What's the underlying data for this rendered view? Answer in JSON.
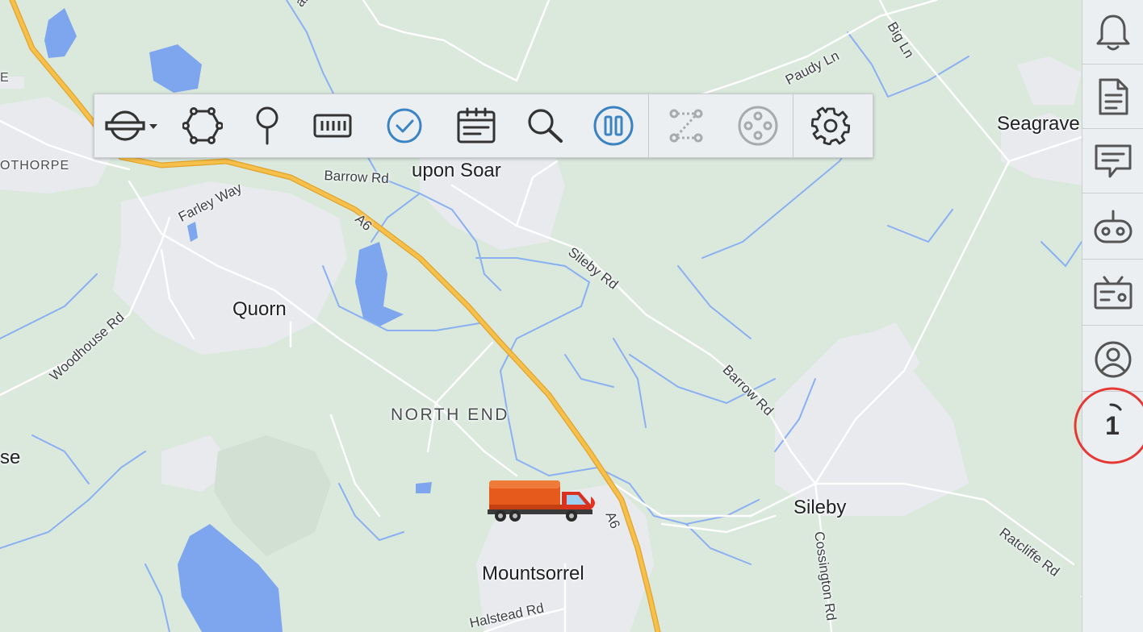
{
  "map": {
    "places": {
      "upon_soar": "upon Soar",
      "quorn": "Quorn",
      "north_end": "NORTH END",
      "mountsorrel": "Mountsorrel",
      "sileby": "Sileby",
      "seagrave": "Seagrave",
      "othorpe": "OTHORPE",
      "se": "se",
      "e_edge": "E",
      "ar_top": "ar"
    },
    "roads": {
      "barrow_rd_1": "Barrow Rd",
      "farley_way": "Farley Way",
      "a6_north": "A6",
      "a6_south": "A6",
      "sileby_rd": "Sileby Rd",
      "barrow_rd_2": "Barrow Rd",
      "woodhouse_rd": "Woodhouse Rd",
      "paudy_ln": "Paudy Ln",
      "big_ln": "Big Ln",
      "cossington_rd": "Cossington Rd",
      "ratcliffe_rd": "Ratcliffe Rd",
      "halstead_rd": "Halstead Rd"
    },
    "colors": {
      "land": "#dbe9dd",
      "urban": "#e8eaed",
      "water": "#7ea6ee",
      "stream": "#8ab0f2",
      "road": "#ffffff",
      "highway": "#f7c04a",
      "highway_edge": "#e0a32e"
    }
  },
  "toolbar": {
    "buttons": [
      {
        "name": "map-layers",
        "icon": "layers-icon"
      },
      {
        "name": "polygon",
        "icon": "polygon-icon"
      },
      {
        "name": "pin",
        "icon": "pin-icon"
      },
      {
        "name": "ruler",
        "icon": "ruler-icon"
      },
      {
        "name": "check",
        "icon": "check-circle-icon",
        "active": true
      },
      {
        "name": "calendar",
        "icon": "calendar-icon"
      },
      {
        "name": "search",
        "icon": "search-icon"
      },
      {
        "name": "pause",
        "icon": "pause-icon",
        "active": true
      },
      {
        "name": "route",
        "icon": "route-icon",
        "disabled": true
      },
      {
        "name": "cluster",
        "icon": "cluster-icon",
        "disabled": true
      },
      {
        "name": "settings",
        "icon": "gear-icon"
      }
    ],
    "colors": {
      "active": "#3a84c4",
      "normal": "#333333",
      "disabled": "#a8abad"
    }
  },
  "sidebar": {
    "items": [
      {
        "name": "notifications",
        "icon": "bell-icon"
      },
      {
        "name": "documents",
        "icon": "document-icon"
      },
      {
        "name": "messages",
        "icon": "message-icon"
      },
      {
        "name": "devices",
        "icon": "gamepad-icon"
      },
      {
        "name": "radio",
        "icon": "radio-icon"
      },
      {
        "name": "account",
        "icon": "account-icon"
      }
    ],
    "counter": "1",
    "counter_color": "#e53935"
  },
  "vehicle": {
    "icon": "truck-icon"
  }
}
